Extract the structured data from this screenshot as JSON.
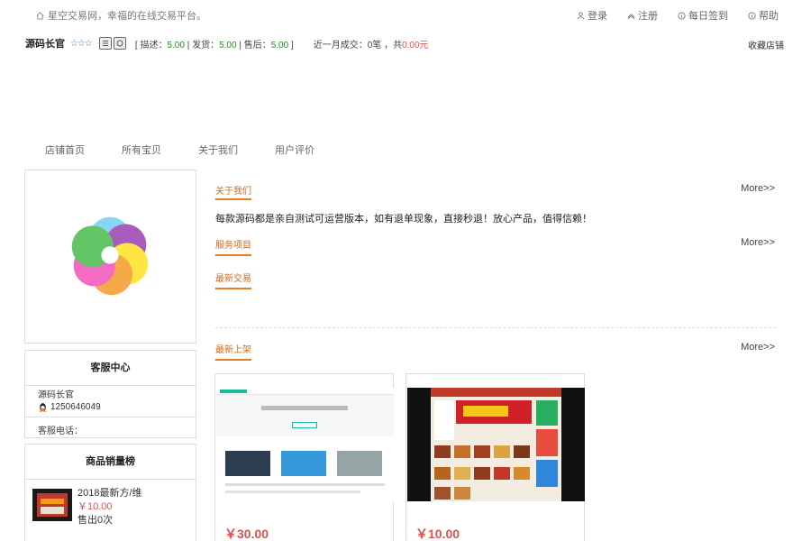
{
  "topbar": {
    "welcome": "星空交易网，幸福的在线交易平台。",
    "login": "登录",
    "register": "注册",
    "checkin": "每日签到",
    "help": "帮助"
  },
  "shop": {
    "name": "源码长官",
    "stars": "☆☆☆",
    "ratings_prefix": "[ 描述：",
    "desc_score": "5.00",
    "ship_label": " | 发货：",
    "ship_score": "5.00",
    "after_label": " | 售后：",
    "after_score": "5.00",
    "ratings_suffix": " ]",
    "month_label": "近一月成交：0笔 ，共",
    "month_amount": "0.00元",
    "favorite": "收藏店铺"
  },
  "nav": {
    "items": [
      "店铺首页",
      "所有宝贝",
      "关于我们",
      "用户评价"
    ]
  },
  "service": {
    "title": "客服中心",
    "name": "源码长官",
    "qq": "1250646049",
    "phone_label": "客服电话："
  },
  "rank": {
    "title": "商品销量榜",
    "item": {
      "name": "2018最新方/维",
      "price": "￥10.00",
      "sold": "售出0次"
    }
  },
  "main": {
    "about_title": "关于我们",
    "about_text": "每款源码都是亲自测试可运营版本，如有退单现象，直接秒退！放心产品，值得信赖！",
    "services_title": "服务项目",
    "latest_trade_title": "最新交易",
    "new_items_title": "最新上架",
    "more": "More>>"
  },
  "products": [
    {
      "price": "￥30.00"
    },
    {
      "price": "￥10.00"
    }
  ],
  "colors": {
    "accent": "#e67e22",
    "price": "#d9534f",
    "star": "#4a78c2"
  }
}
